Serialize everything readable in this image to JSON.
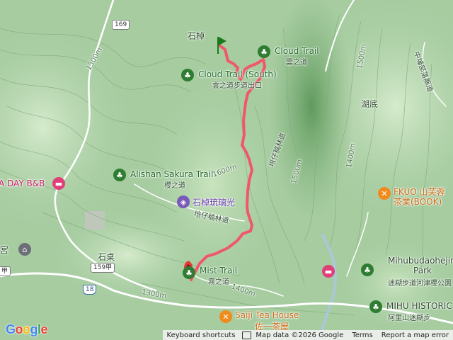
{
  "route": {
    "color": "#f0576a",
    "start_marker_color": "#1a7a1a",
    "end_marker_color": "#e53935"
  },
  "colors": {
    "terrain_light": "#c7e2bd",
    "terrain_dark": "#6fa86d",
    "road": "#ffffff",
    "river": "#a9c8d8"
  },
  "places": {
    "shizhuo": "石棹",
    "cloud_trail": "Cloud Trail",
    "cloud_trail_zh": "雲之道",
    "cloud_trail_south": "Cloud Trail (South)",
    "cloud_trail_south_zh": "雲之道步道出口",
    "hudi": "湖底",
    "alishan_sakura_trail": "Alishan Sakura Trail",
    "alishan_sakura_trail_zh": "櫻之道",
    "glass_shop": "石棹琉璃光",
    "tea_trail": "培仔稿林道",
    "tea_trail_2": "培仔稿林道",
    "zhongpu_road": "中埔部落縣道",
    "a_day_bnb": "A DAY B&B",
    "fkuo": "FKUO 山芙蓉",
    "fkuo_zh": "茶業(BOOK)",
    "mihu_park": "Mihubudaohejiny",
    "mihu_park_2": "Park",
    "mihu_park_zh": "迷糊步道河津櫻公園",
    "mihu_historic": "MIHU HISTORIC",
    "mihu_historic_zh": "阿里山迷糊步",
    "mist_trail": "Mist Trail",
    "mist_trail_zh": "霧之道",
    "saiji_tea_house": "Saiji Tea House",
    "saiji_tea_house_zh": "佐一茶屋",
    "shiquan": "石桌",
    "temple": "宮",
    "b_and_b_left": "A DAY B&B"
  },
  "contours": {
    "c1300_a": "1300m",
    "c1300_b": "1300m",
    "c1400_a": "1400m",
    "c1400_b": "1400m",
    "c1500_a": "1500m",
    "c1500_b": "1500m",
    "c1600": "1600m"
  },
  "roads": {
    "r169": "169",
    "r159a": "159甲",
    "r18": "18",
    "r159a_left": "甲"
  },
  "attribution": {
    "shortcuts": "Keyboard shortcuts",
    "map_data": "Map data ©2026 Google",
    "terms": "Terms",
    "report": "Report a map error"
  },
  "logo": {
    "g1": "G",
    "g2": "o",
    "g3": "o",
    "g4": "g",
    "g5": "l",
    "g6": "e"
  }
}
